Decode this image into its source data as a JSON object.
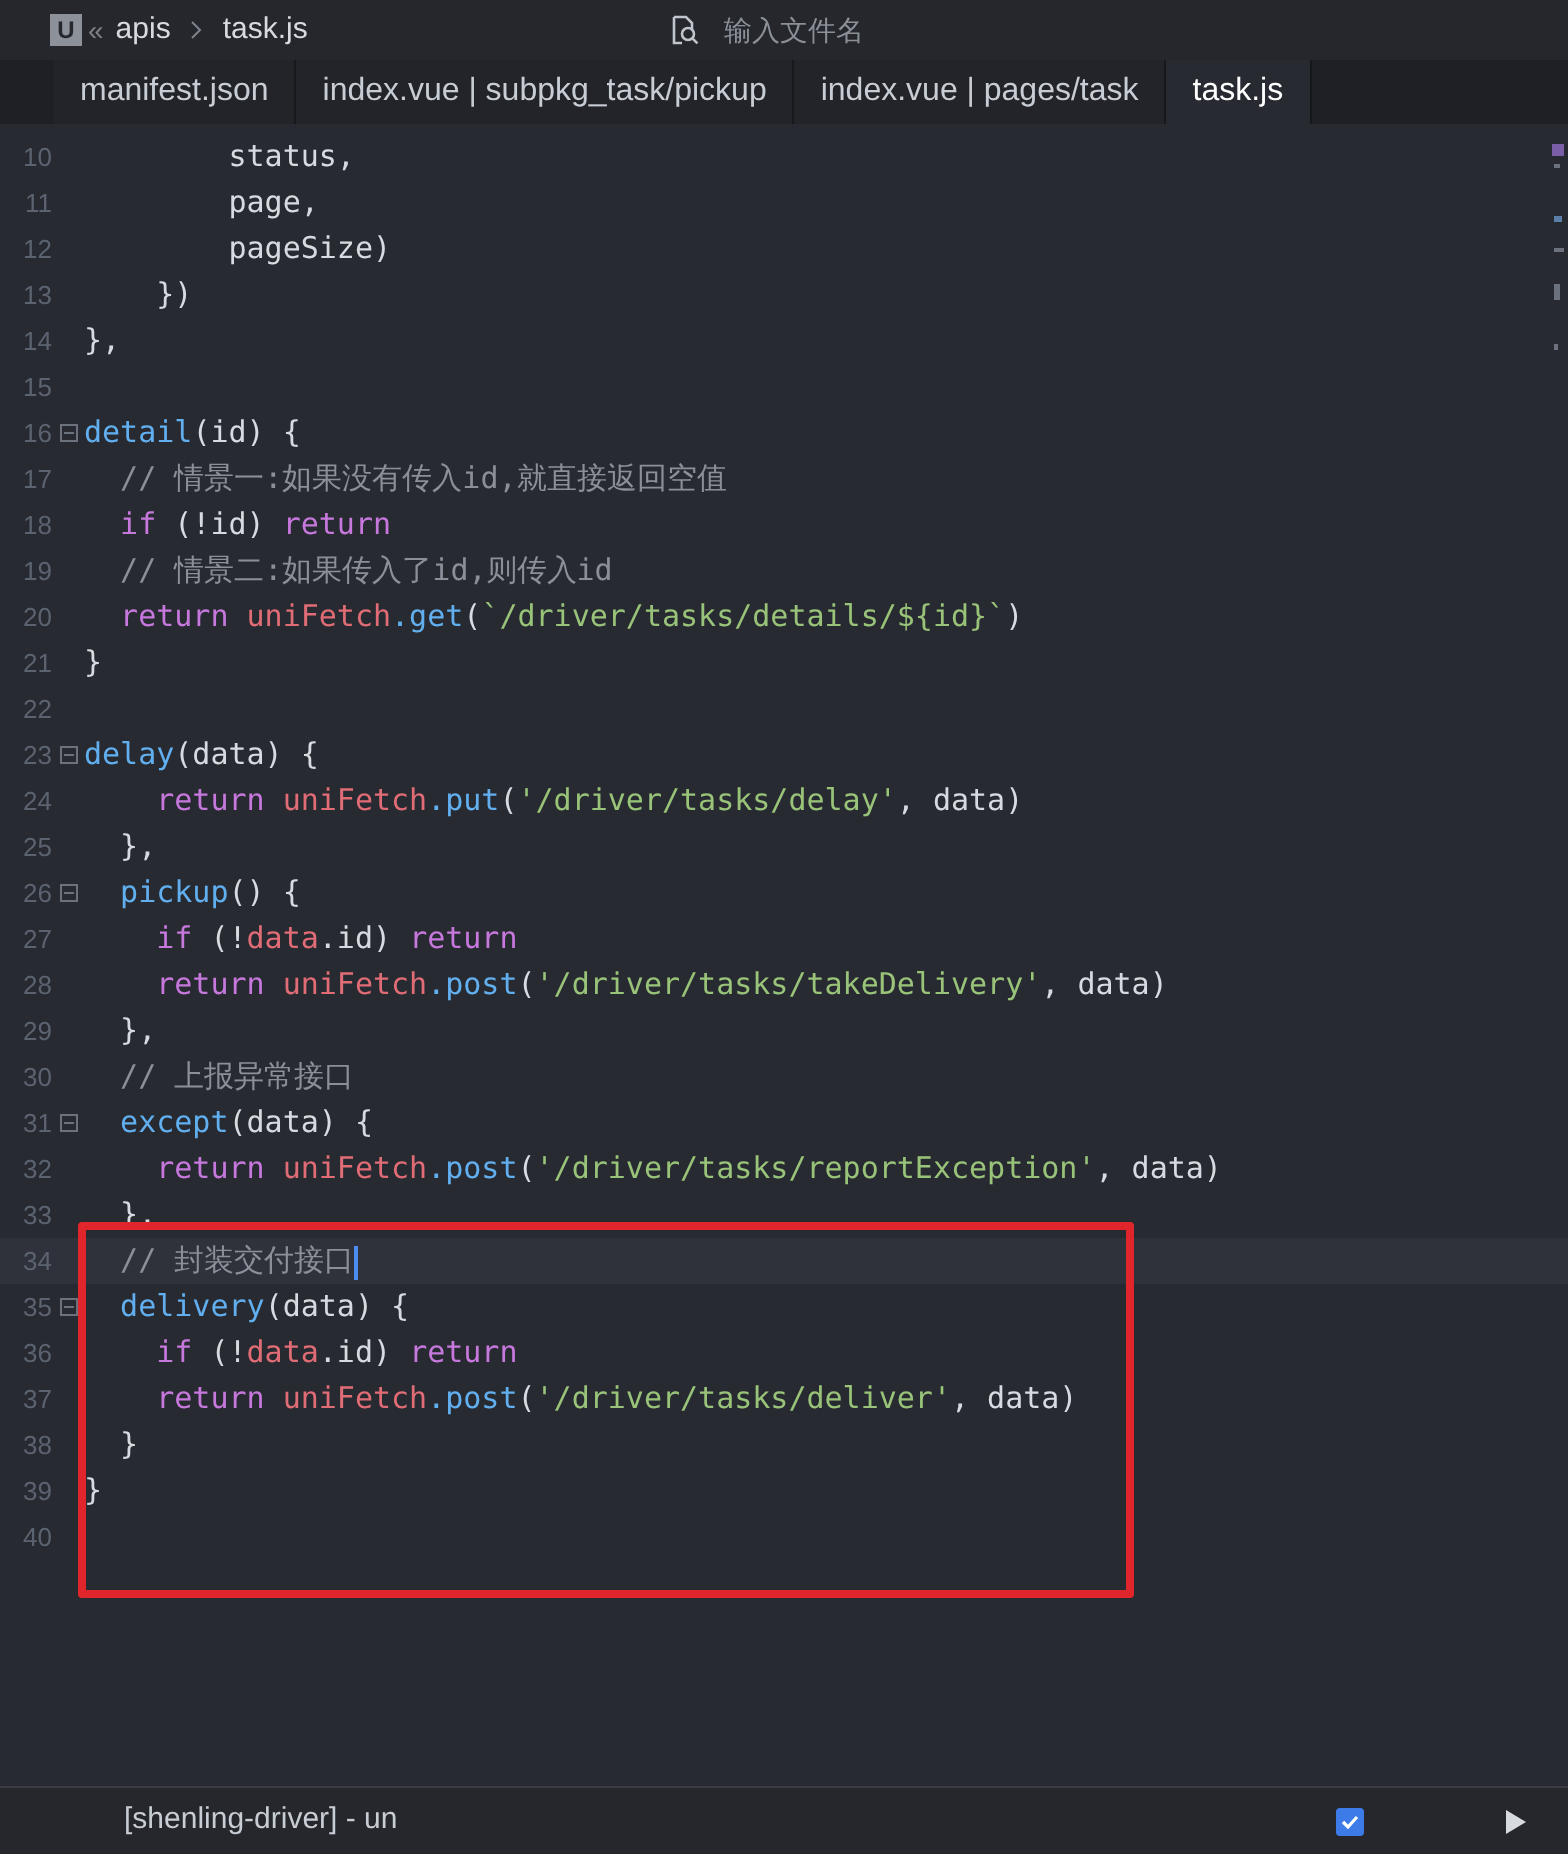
{
  "breadcrumb": {
    "logo": "U",
    "separator": "«",
    "items": [
      "apis",
      "task.js"
    ]
  },
  "search": {
    "placeholder": "输入文件名"
  },
  "tabs": [
    {
      "label": "manifest.json",
      "selected": false
    },
    {
      "label": "index.vue | subpkg_task/pickup",
      "selected": false
    },
    {
      "label": "index.vue | pages/task",
      "selected": false
    },
    {
      "label": "task.js",
      "selected": true
    }
  ],
  "editor": {
    "lines": [
      {
        "number": "10",
        "fold": false,
        "current": false,
        "tokens": [
          {
            "t": "        status,",
            "kind": "plain"
          }
        ]
      },
      {
        "number": "11",
        "fold": false,
        "current": false,
        "tokens": [
          {
            "t": "        page,",
            "kind": "plain"
          }
        ]
      },
      {
        "number": "12",
        "fold": false,
        "current": false,
        "tokens": [
          {
            "t": "        pageSize)",
            "kind": "plain"
          }
        ]
      },
      {
        "number": "13",
        "fold": false,
        "current": false,
        "tokens": [
          {
            "t": "    })",
            "kind": "plain"
          }
        ]
      },
      {
        "number": "14",
        "fold": false,
        "current": false,
        "tokens": [
          {
            "t": "},",
            "kind": "plain"
          }
        ]
      },
      {
        "number": "15",
        "fold": false,
        "current": false
      },
      {
        "number": "16",
        "fold": true,
        "current": false,
        "tokens": [
          {
            "t": "detail",
            "kind": "func"
          },
          {
            "t": "(id) {",
            "kind": "plain"
          }
        ]
      },
      {
        "number": "17",
        "fold": false,
        "current": false,
        "tokens": [
          {
            "t": "  // 情景一:如果没有传入id,就直接返回空值",
            "kind": "comment"
          }
        ]
      },
      {
        "number": "18",
        "fold": false,
        "current": false,
        "tokens": [
          {
            "t": "  if",
            "kind": "keyword"
          },
          {
            "t": " (!id) ",
            "kind": "plain"
          },
          {
            "t": "return",
            "kind": "keyword"
          }
        ]
      },
      {
        "number": "19",
        "fold": false,
        "current": false,
        "tokens": [
          {
            "t": "  // 情景二:如果传入了id,则传入id",
            "kind": "comment"
          }
        ]
      },
      {
        "number": "20",
        "fold": false,
        "current": false,
        "tokens": [
          {
            "t": "  return",
            "kind": "keyword"
          },
          {
            "t": " uniFetch",
            "kind": "object"
          },
          {
            "t": ".get",
            "kind": "func"
          },
          {
            "t": "(",
            "kind": "plain"
          },
          {
            "t": "`/driver/tasks/details/${id}`",
            "kind": "string"
          },
          {
            "t": ")",
            "kind": "plain"
          }
        ]
      },
      {
        "number": "21",
        "fold": false,
        "current": false,
        "tokens": [
          {
            "t": "}",
            "kind": "plain"
          }
        ]
      },
      {
        "number": "22",
        "fold": false,
        "current": false
      },
      {
        "number": "23",
        "fold": true,
        "current": false,
        "tokens": [
          {
            "t": "delay",
            "kind": "func"
          },
          {
            "t": "(data) {",
            "kind": "plain"
          }
        ]
      },
      {
        "number": "24",
        "fold": false,
        "current": false,
        "tokens": [
          {
            "t": "    return",
            "kind": "keyword"
          },
          {
            "t": " uniFetch",
            "kind": "object"
          },
          {
            "t": ".put",
            "kind": "func"
          },
          {
            "t": "(",
            "kind": "plain"
          },
          {
            "t": "'/driver/tasks/delay'",
            "kind": "string"
          },
          {
            "t": ", data)",
            "kind": "plain"
          }
        ]
      },
      {
        "number": "25",
        "fold": false,
        "current": false,
        "tokens": [
          {
            "t": "  },",
            "kind": "plain"
          }
        ]
      },
      {
        "number": "26",
        "fold": true,
        "current": false,
        "tokens": [
          {
            "t": "  pickup",
            "kind": "func"
          },
          {
            "t": "() {",
            "kind": "plain"
          }
        ]
      },
      {
        "number": "27",
        "fold": false,
        "current": false,
        "tokens": [
          {
            "t": "    if",
            "kind": "keyword"
          },
          {
            "t": " (!",
            "kind": "plain"
          },
          {
            "t": "data",
            "kind": "object"
          },
          {
            "t": ".id) ",
            "kind": "plain"
          },
          {
            "t": "return",
            "kind": "keyword"
          }
        ]
      },
      {
        "number": "28",
        "fold": false,
        "current": false,
        "tokens": [
          {
            "t": "    return",
            "kind": "keyword"
          },
          {
            "t": " uniFetch",
            "kind": "object"
          },
          {
            "t": ".post",
            "kind": "func"
          },
          {
            "t": "(",
            "kind": "plain"
          },
          {
            "t": "'/driver/tasks/takeDelivery'",
            "kind": "string"
          },
          {
            "t": ", data)",
            "kind": "plain"
          }
        ]
      },
      {
        "number": "29",
        "fold": false,
        "current": false,
        "tokens": [
          {
            "t": "  },",
            "kind": "plain"
          }
        ]
      },
      {
        "number": "30",
        "fold": false,
        "current": false,
        "tokens": [
          {
            "t": "  // 上报异常接口",
            "kind": "comment"
          }
        ]
      },
      {
        "number": "31",
        "fold": true,
        "current": false,
        "tokens": [
          {
            "t": "  except",
            "kind": "func"
          },
          {
            "t": "(data) {",
            "kind": "plain"
          }
        ]
      },
      {
        "number": "32",
        "fold": false,
        "current": false,
        "tokens": [
          {
            "t": "    return",
            "kind": "keyword"
          },
          {
            "t": " uniFetch",
            "kind": "object"
          },
          {
            "t": ".post",
            "kind": "func"
          },
          {
            "t": "(",
            "kind": "plain"
          },
          {
            "t": "'/driver/tasks/reportException'",
            "kind": "string"
          },
          {
            "t": ", data)",
            "kind": "plain"
          }
        ]
      },
      {
        "number": "33",
        "fold": false,
        "current": false,
        "tokens": [
          {
            "t": "  },",
            "kind": "plain"
          }
        ]
      },
      {
        "number": "34",
        "fold": false,
        "current": true,
        "tokens": [
          {
            "t": "  // 封装交付接口",
            "kind": "comment"
          }
        ]
      },
      {
        "number": "35",
        "fold": true,
        "current": false,
        "tokens": [
          {
            "t": "  delivery",
            "kind": "func"
          },
          {
            "t": "(data) {",
            "kind": "plain"
          }
        ]
      },
      {
        "number": "36",
        "fold": false,
        "current": false,
        "tokens": [
          {
            "t": "    if",
            "kind": "keyword"
          },
          {
            "t": " (!",
            "kind": "plain"
          },
          {
            "t": "data",
            "kind": "object"
          },
          {
            "t": ".id) ",
            "kind": "plain"
          },
          {
            "t": "return",
            "kind": "keyword"
          }
        ]
      },
      {
        "number": "37",
        "fold": false,
        "current": false,
        "tokens": [
          {
            "t": "    return",
            "kind": "keyword"
          },
          {
            "t": " uniFetch",
            "kind": "object"
          },
          {
            "t": ".post",
            "kind": "func"
          },
          {
            "t": "(",
            "kind": "plain"
          },
          {
            "t": "'/driver/tasks/deliver'",
            "kind": "string"
          },
          {
            "t": ", data)",
            "kind": "plain"
          }
        ]
      },
      {
        "number": "38",
        "fold": false,
        "current": false,
        "tokens": [
          {
            "t": "  }",
            "kind": "plain"
          }
        ]
      },
      {
        "number": "39",
        "fold": false,
        "current": false,
        "tokens": [
          {
            "t": "}",
            "kind": "plain"
          }
        ]
      },
      {
        "number": "40",
        "fold": false,
        "current": false
      }
    ]
  },
  "console": {
    "project": "[shenling-driver] - un",
    "checkbox_checked": true
  }
}
